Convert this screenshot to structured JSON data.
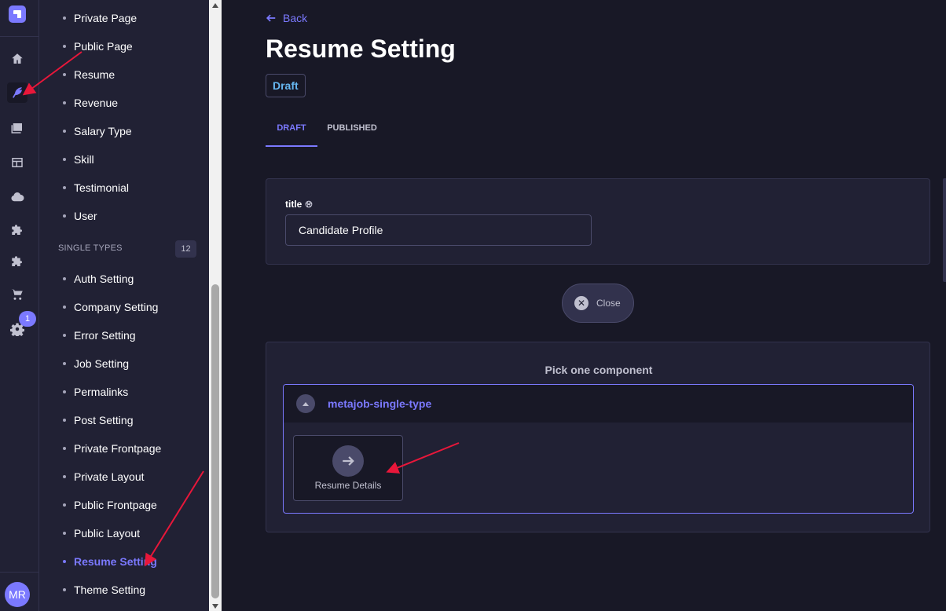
{
  "rail": {
    "icons": [
      "home-icon",
      "feather-icon",
      "media-icon",
      "layout-icon",
      "cloud-icon",
      "puzzle-icon",
      "puzzle-icon",
      "cart-icon",
      "gear-icon"
    ],
    "active_icon": "feather-icon",
    "settings_badge": "1",
    "user_initials": "MR"
  },
  "subnav": {
    "collection_items": [
      "Private Page",
      "Public Page",
      "Resume",
      "Revenue",
      "Salary Type",
      "Skill",
      "Testimonial",
      "User"
    ],
    "single_types_label": "SINGLE TYPES",
    "single_types_count": "12",
    "single_type_items": [
      "Auth Setting",
      "Company Setting",
      "Error Setting",
      "Job Setting",
      "Permalinks",
      "Post Setting",
      "Private Frontpage",
      "Private Layout",
      "Public Frontpage",
      "Public Layout",
      "Resume Setting",
      "Theme Setting"
    ],
    "active_item": "Resume Setting"
  },
  "header": {
    "back_label": "Back",
    "title": "Resume Setting",
    "status": "Draft"
  },
  "tabs": [
    {
      "label": "DRAFT",
      "active": true
    },
    {
      "label": "PUBLISHED",
      "active": false
    }
  ],
  "form": {
    "title_label": "title",
    "title_value": "Candidate Profile"
  },
  "close_button_label": "Close",
  "picker": {
    "heading": "Pick one component",
    "category": "metajob-single-type",
    "components": [
      {
        "label": "Resume Details",
        "icon": "arrow-right-icon"
      }
    ]
  },
  "colors": {
    "accent": "#7b79ff",
    "background": "#181826",
    "surface": "#212134",
    "annotation": "#e8173a"
  }
}
